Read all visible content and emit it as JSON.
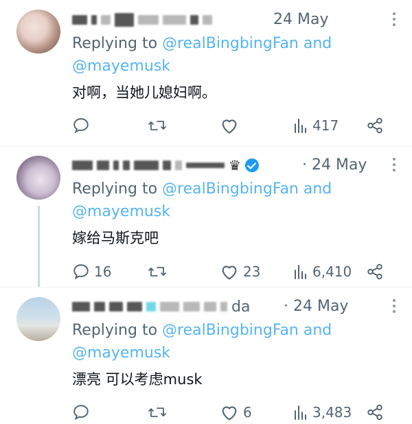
{
  "tweets": [
    {
      "date": "24 May",
      "reply_prefix": "Replying to",
      "reply_handles_line1": "@realBingbingFan and",
      "reply_handles_line2": "@mayemusk",
      "text": "对啊，当她儿媳妇啊。",
      "replies": "",
      "likes": "",
      "views": "417"
    },
    {
      "date": "· 24 May",
      "reply_prefix": "Replying to",
      "reply_handles_line1": "@realBingbingFan and",
      "reply_handles_line2": "@mayemusk",
      "text": "嫁给马斯克吧",
      "replies": "16",
      "likes": "23",
      "views": "6,410",
      "crown": "♛"
    },
    {
      "name_tail": "da",
      "date": "· 24 May",
      "reply_prefix": "Replying to",
      "reply_handles_line1": "@realBingbingFan and",
      "reply_handles_line2": "@mayemusk",
      "text": "漂亮  可以考虑musk",
      "replies": "",
      "likes": "6",
      "views": "3,483"
    }
  ],
  "icons": {
    "reply": "reply-icon",
    "retweet": "retweet-icon",
    "like": "like-icon",
    "views": "views-icon",
    "share": "share-icon",
    "more": "more-icon",
    "verified": "verified-badge-icon"
  },
  "colors": {
    "text": "#0f1419",
    "muted": "#536471",
    "link": "#1d9bf0"
  }
}
